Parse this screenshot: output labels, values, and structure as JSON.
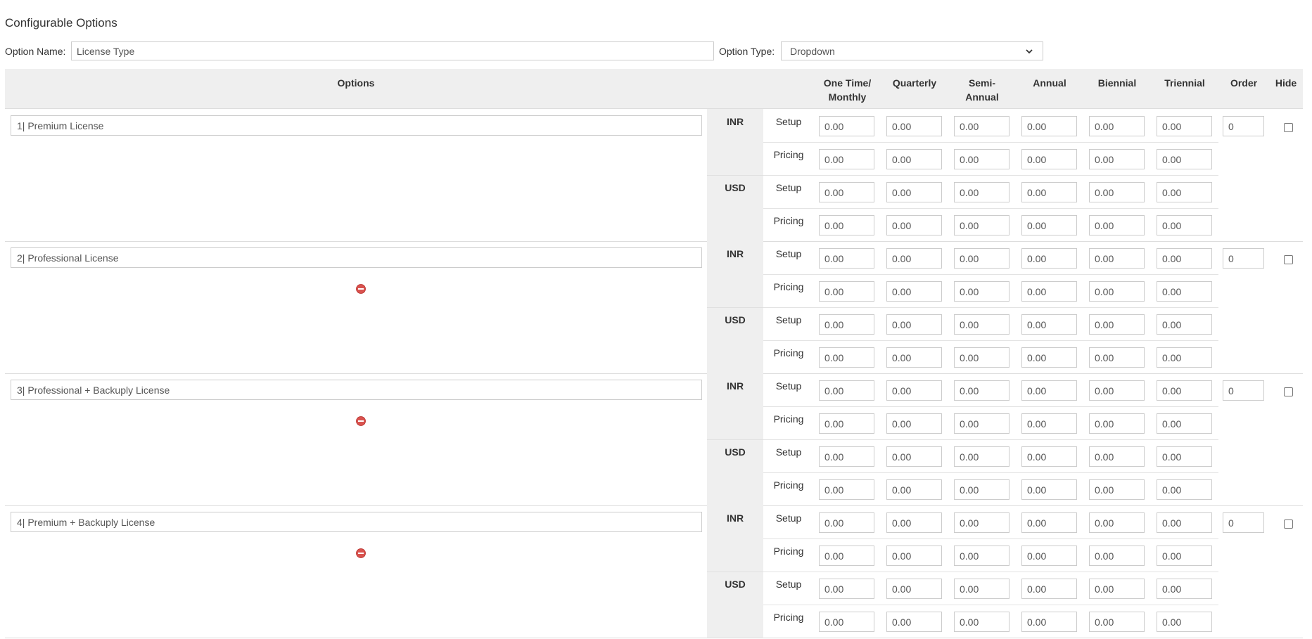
{
  "page": {
    "title": "Configurable Options",
    "option_name_label": "Option Name:",
    "option_name_value": "License Type",
    "option_type_label": "Option Type:",
    "option_type_value": "Dropdown"
  },
  "columns": {
    "options": "Options",
    "one_time_line1": "One Time/",
    "one_time_line2": "Monthly",
    "quarterly": "Quarterly",
    "semi_line1": "Semi-",
    "semi_line2": "Annual",
    "annual": "Annual",
    "biennial": "Biennial",
    "triennial": "Triennial",
    "order": "Order",
    "hide": "Hide"
  },
  "labels": {
    "setup": "Setup",
    "pricing": "Pricing"
  },
  "currencies": [
    "INR",
    "USD"
  ],
  "icons": {
    "remove": "remove-icon",
    "dropdown": "chevron-down-icon"
  },
  "colors": {
    "remove": "#d9534f",
    "header_bg": "#efefef"
  },
  "options": [
    {
      "name": "1| Premium License",
      "order": "0",
      "hidden": false,
      "removable": false,
      "prices": {
        "INR": {
          "setup": [
            "0.00",
            "0.00",
            "0.00",
            "0.00",
            "0.00",
            "0.00"
          ],
          "pricing": [
            "0.00",
            "0.00",
            "0.00",
            "0.00",
            "0.00",
            "0.00"
          ]
        },
        "USD": {
          "setup": [
            "0.00",
            "0.00",
            "0.00",
            "0.00",
            "0.00",
            "0.00"
          ],
          "pricing": [
            "0.00",
            "0.00",
            "0.00",
            "0.00",
            "0.00",
            "0.00"
          ]
        }
      }
    },
    {
      "name": "2| Professional License",
      "order": "0",
      "hidden": false,
      "removable": true,
      "prices": {
        "INR": {
          "setup": [
            "0.00",
            "0.00",
            "0.00",
            "0.00",
            "0.00",
            "0.00"
          ],
          "pricing": [
            "0.00",
            "0.00",
            "0.00",
            "0.00",
            "0.00",
            "0.00"
          ]
        },
        "USD": {
          "setup": [
            "0.00",
            "0.00",
            "0.00",
            "0.00",
            "0.00",
            "0.00"
          ],
          "pricing": [
            "0.00",
            "0.00",
            "0.00",
            "0.00",
            "0.00",
            "0.00"
          ]
        }
      }
    },
    {
      "name": "3| Professional + Backuply License",
      "order": "0",
      "hidden": false,
      "removable": true,
      "prices": {
        "INR": {
          "setup": [
            "0.00",
            "0.00",
            "0.00",
            "0.00",
            "0.00",
            "0.00"
          ],
          "pricing": [
            "0.00",
            "0.00",
            "0.00",
            "0.00",
            "0.00",
            "0.00"
          ]
        },
        "USD": {
          "setup": [
            "0.00",
            "0.00",
            "0.00",
            "0.00",
            "0.00",
            "0.00"
          ],
          "pricing": [
            "0.00",
            "0.00",
            "0.00",
            "0.00",
            "0.00",
            "0.00"
          ]
        }
      }
    },
    {
      "name": "4| Premium + Backuply License",
      "order": "0",
      "hidden": false,
      "removable": true,
      "prices": {
        "INR": {
          "setup": [
            "0.00",
            "0.00",
            "0.00",
            "0.00",
            "0.00",
            "0.00"
          ],
          "pricing": [
            "0.00",
            "0.00",
            "0.00",
            "0.00",
            "0.00",
            "0.00"
          ]
        },
        "USD": {
          "setup": [
            "0.00",
            "0.00",
            "0.00",
            "0.00",
            "0.00",
            "0.00"
          ],
          "pricing": [
            "0.00",
            "0.00",
            "0.00",
            "0.00",
            "0.00",
            "0.00"
          ]
        }
      }
    }
  ]
}
